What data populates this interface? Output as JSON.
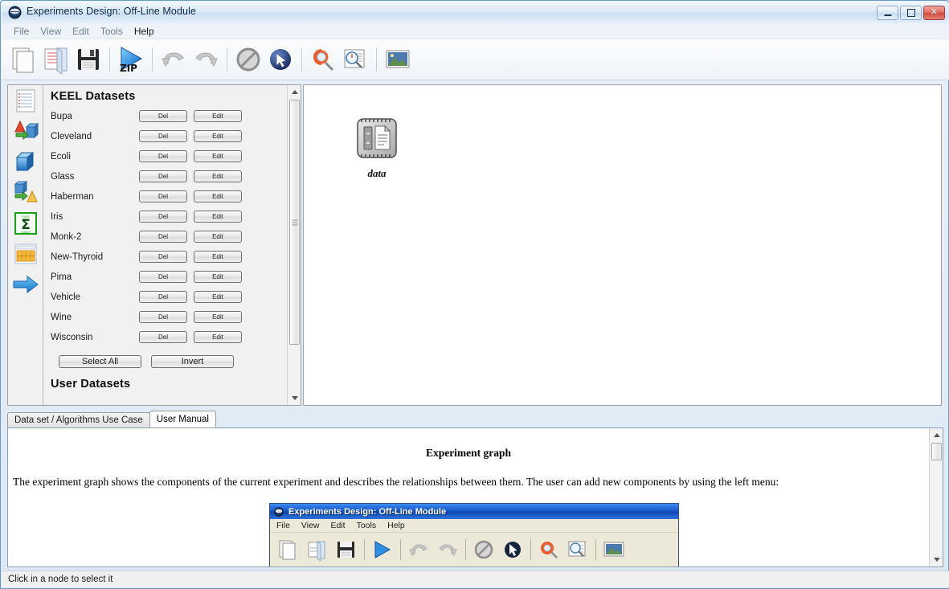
{
  "window": {
    "title": "Experiments Design: Off-Line Module",
    "app_icon": "globe-icon",
    "controls": {
      "minimize": "minimize-button",
      "maximize": "maximize-button",
      "close": "close-button",
      "close_glyph": "✕"
    }
  },
  "menubar": {
    "items": [
      {
        "label": "File",
        "emphasis": false
      },
      {
        "label": "View",
        "emphasis": false
      },
      {
        "label": "Edit",
        "emphasis": false
      },
      {
        "label": "Tools",
        "emphasis": false
      },
      {
        "label": "Help",
        "emphasis": true
      }
    ]
  },
  "toolbar": {
    "buttons": [
      {
        "name": "new-experiment-icon",
        "tip": "New"
      },
      {
        "name": "open-experiment-icon",
        "tip": "Open"
      },
      {
        "name": "save-experiment-icon",
        "tip": "Save"
      },
      {
        "name": "export-zip-icon",
        "tip": "ZIP",
        "badge": "ZIP"
      },
      {
        "name": "undo-icon",
        "tip": "Undo"
      },
      {
        "name": "redo-icon",
        "tip": "Redo"
      },
      {
        "name": "cancel-icon",
        "tip": "Cancel"
      },
      {
        "name": "select-pointer-icon",
        "tip": "Select"
      },
      {
        "name": "zoom-help-icon",
        "tip": "Help zoom"
      },
      {
        "name": "zoom-page-icon",
        "tip": "Zoom page"
      },
      {
        "name": "image-icon",
        "tip": "Picture"
      }
    ]
  },
  "sidebar": {
    "items": [
      {
        "name": "sidebar-item-datasets",
        "icon": "lined-paper-icon",
        "label": "Datasets"
      },
      {
        "name": "sidebar-item-preprocess",
        "icon": "cone-to-cube-icon",
        "label": "Preprocess"
      },
      {
        "name": "sidebar-item-methods",
        "icon": "blue-cube-icon",
        "label": "Methods"
      },
      {
        "name": "sidebar-item-postprocess",
        "icon": "cube-to-cone-icon",
        "label": "Postprocess"
      },
      {
        "name": "sidebar-item-statistics",
        "icon": "sigma-icon",
        "label": "Statistical tests"
      },
      {
        "name": "sidebar-item-visualization",
        "icon": "table-grid-icon",
        "label": "Visualization"
      },
      {
        "name": "sidebar-item-connection",
        "icon": "blue-arrow-icon",
        "label": "Connection"
      }
    ]
  },
  "datasets_panel": {
    "keel_header": "KEEL Datasets",
    "user_header": "User Datasets",
    "row_buttons": {
      "del": "Del",
      "edit": "Edit"
    },
    "items": [
      "Bupa",
      "Cleveland",
      "Ecoli",
      "Glass",
      "Haberman",
      "Iris",
      "Monk-2",
      "New-Thyroid",
      "Pima",
      "Vehicle",
      "Wine",
      "Wisconsin"
    ],
    "select_all": "Select All",
    "invert": "Invert"
  },
  "graph": {
    "nodes": [
      {
        "label": "data",
        "icon": "data-node-icon"
      }
    ]
  },
  "tabs": [
    {
      "label": "Data set / Algorithms Use Case",
      "active": false
    },
    {
      "label": "User Manual",
      "active": true
    }
  ],
  "manual": {
    "title": "Experiment graph",
    "paragraph": "The experiment graph shows the components of the current experiment and describes the relationships between them. The user can add new components by using the left menu:",
    "embedded_screenshot": {
      "title": "Experiments Design: Off-Line Module",
      "menu": [
        "File",
        "View",
        "Edit",
        "Tools",
        "Help"
      ]
    }
  },
  "statusbar": {
    "text": "Click in a node to select it"
  },
  "colors": {
    "title_text": "#0a2a4a",
    "accent_blue": "#1456c8",
    "close_red": "#d04a3c",
    "panel_bg": "#f1f1f1",
    "canvas_bg": "#ffffff",
    "sigma_green": "#18a018"
  }
}
